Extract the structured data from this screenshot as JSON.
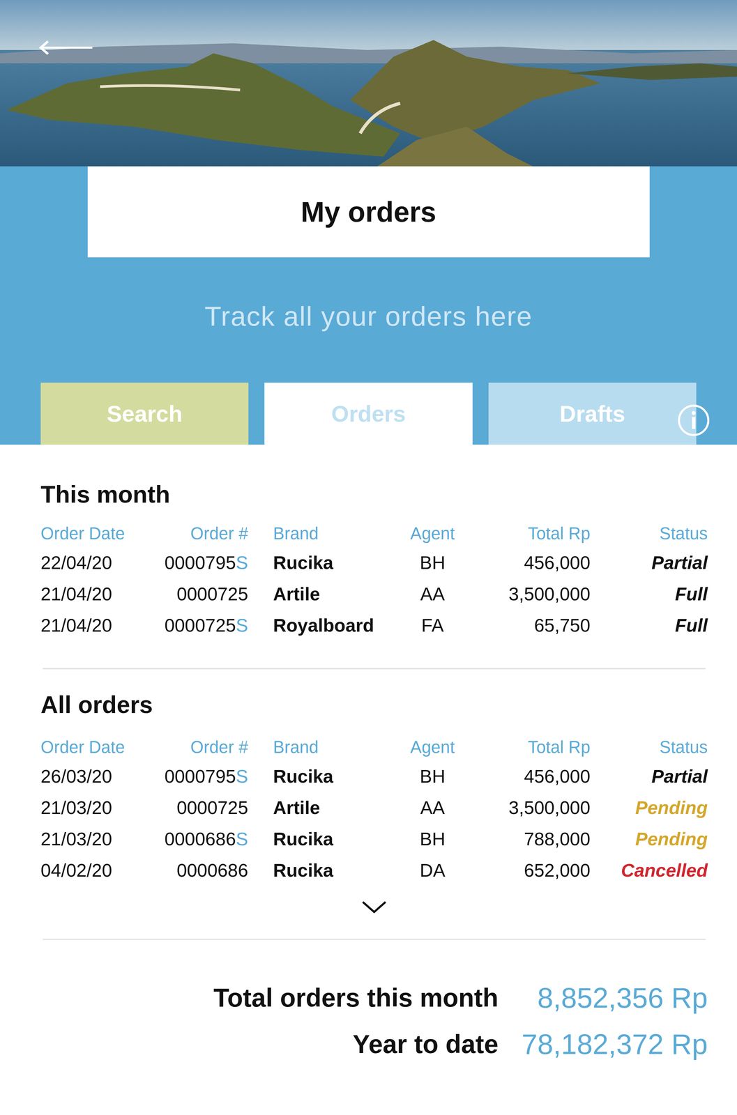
{
  "header": {
    "title": "My orders",
    "subtitle": "Track all your orders here"
  },
  "tabs": [
    {
      "label": "Search",
      "selected": false,
      "color": "#d3dc9e"
    },
    {
      "label": "Orders",
      "selected": true,
      "color": "#ffffff"
    },
    {
      "label": "Drafts",
      "selected": false,
      "color": "#b8dcef"
    }
  ],
  "this_month": {
    "title": "This month",
    "columns": [
      "Order Date",
      "Order #",
      "Brand",
      "Agent",
      "Total Rp",
      "Status"
    ],
    "rows": [
      {
        "date": "22/04/20",
        "order": "0000795",
        "suffix": "S",
        "brand": "Rucika",
        "agent": "BH",
        "total": "456,000",
        "status": "Partial",
        "color": "#111111"
      },
      {
        "date": "21/04/20",
        "order": "0000725",
        "brand": "Artile",
        "agent": "AA",
        "total": "3,500,000",
        "status": "Full",
        "color": "#111111"
      },
      {
        "date": "21/04/20",
        "order": "0000725",
        "suffix": "S",
        "brand": "Royalboard",
        "agent": "FA",
        "total": "65,750",
        "status": "Full",
        "color": "#111111"
      }
    ]
  },
  "all_orders": {
    "title": "All orders",
    "columns": [
      "Order Date",
      "Order #",
      "Brand",
      "Agent",
      "Total Rp",
      "Status"
    ],
    "rows": [
      {
        "date": "26/03/20",
        "order": "0000795",
        "suffix": "S",
        "brand": "Rucika",
        "agent": "BH",
        "total": "456,000",
        "status": "Partial",
        "color": "#111111"
      },
      {
        "date": "21/03/20",
        "order": "0000725",
        "brand": "Artile",
        "agent": "AA",
        "total": "3,500,000",
        "status": "Pending",
        "color": "#d4a72c"
      },
      {
        "date": "21/03/20",
        "order": "0000686",
        "suffix": "S",
        "brand": "Rucika",
        "agent": "BH",
        "total": "788,000",
        "status": "Pending",
        "color": "#d4a72c"
      },
      {
        "date": "04/02/20",
        "order": "0000686",
        "brand": "Rucika",
        "agent": "DA",
        "total": "652,000",
        "status": "Cancelled",
        "color": "#d0262e"
      }
    ]
  },
  "totals": [
    {
      "label": "Total orders this month",
      "value": "8,852,356 Rp"
    },
    {
      "label": "Year to date",
      "value": "78,182,372 Rp"
    }
  ]
}
